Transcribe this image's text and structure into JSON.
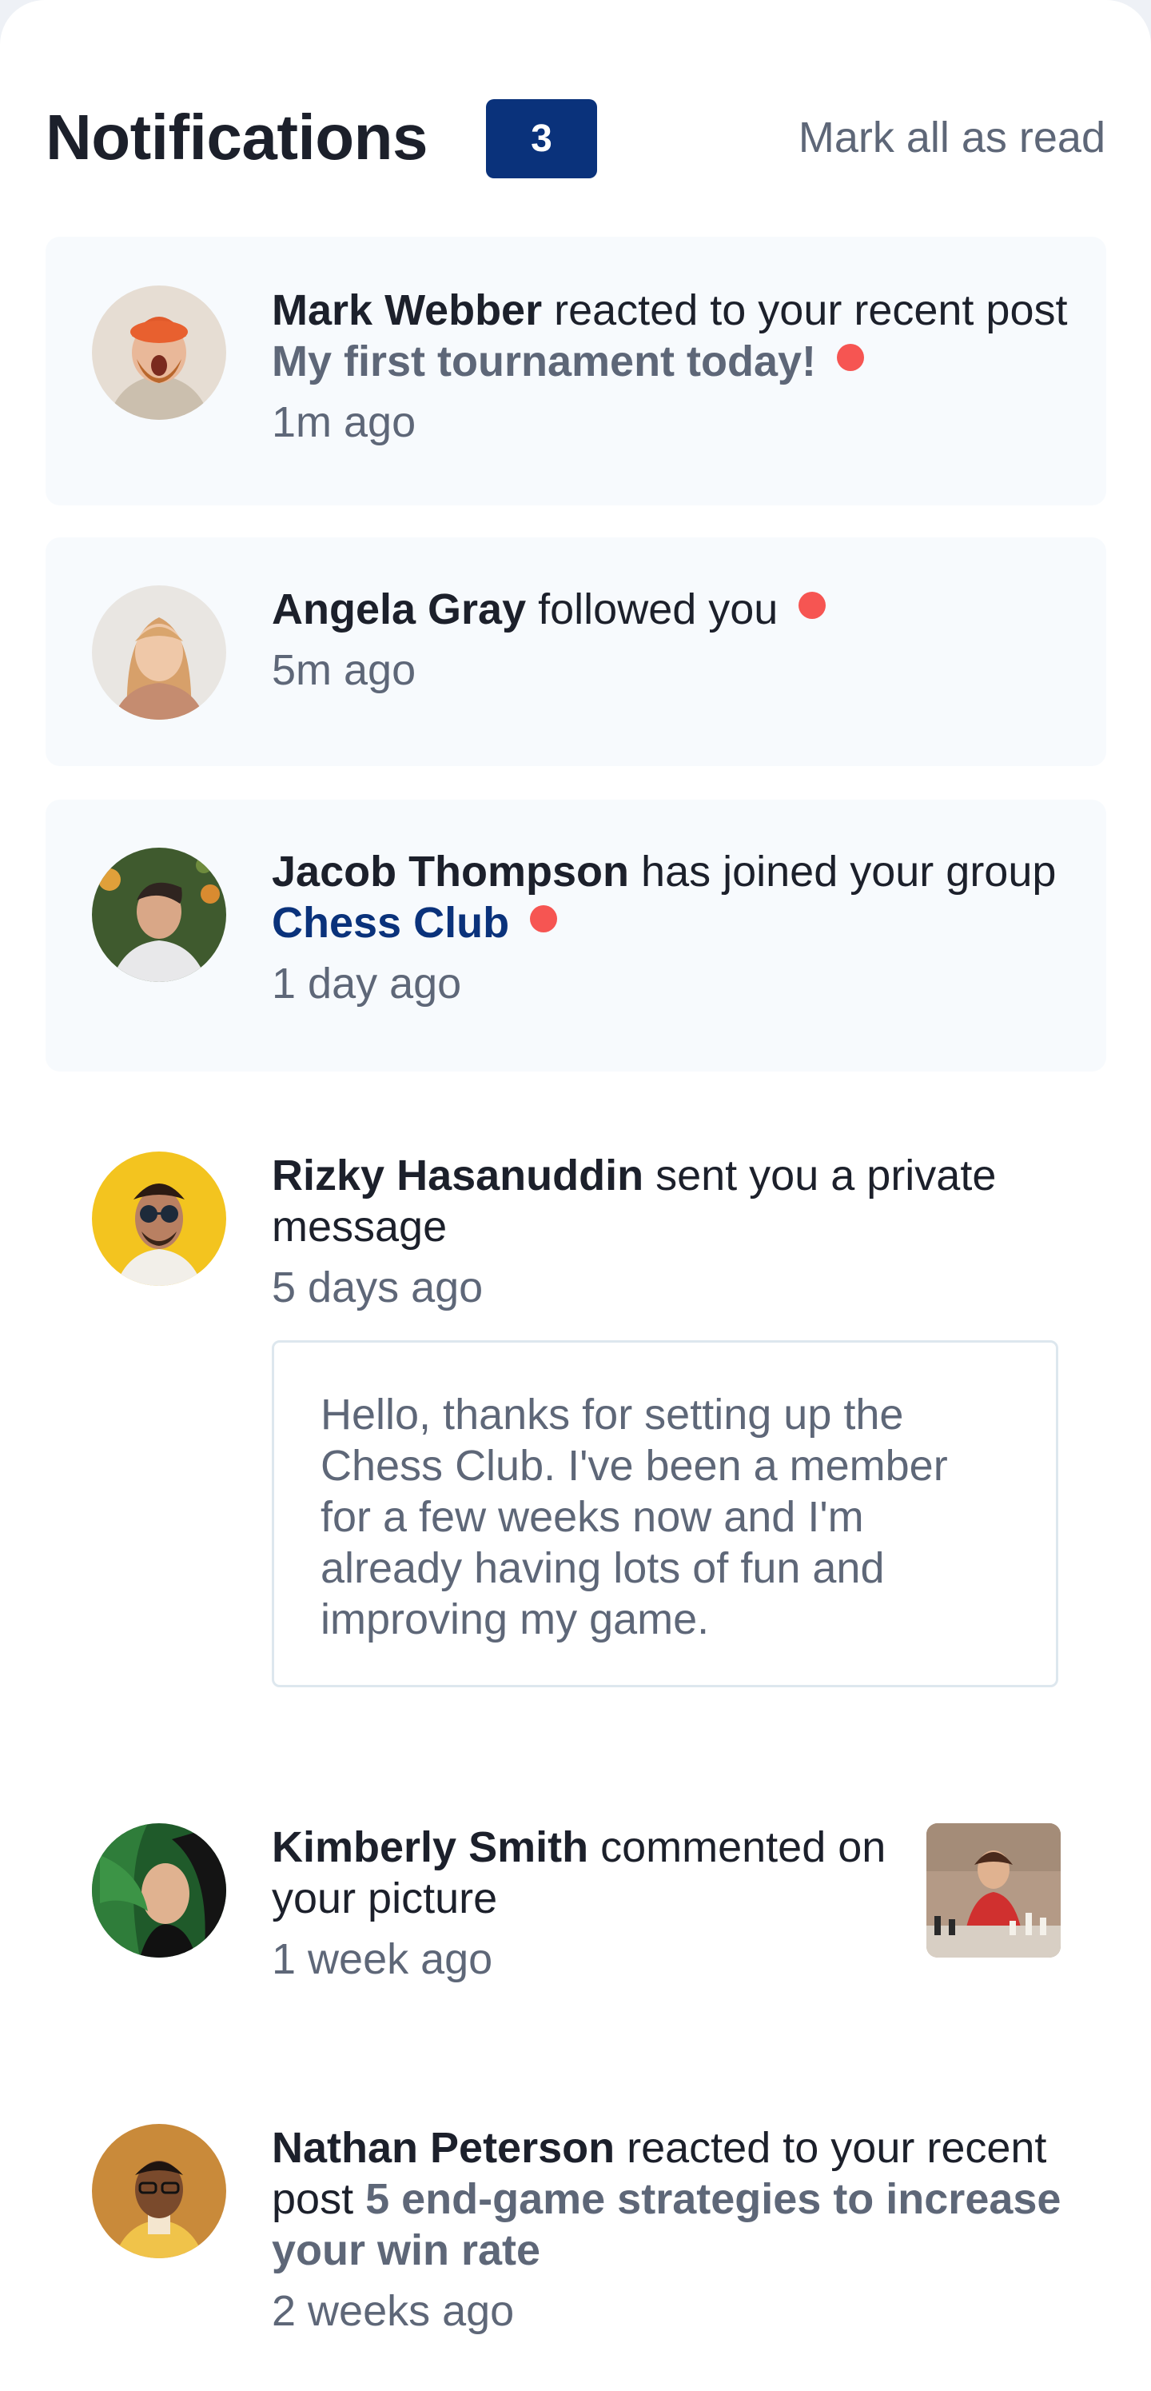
{
  "header": {
    "title": "Notifications",
    "unread_count": "3",
    "mark_all_label": "Mark all as read"
  },
  "colors": {
    "badge": "#0a327b",
    "unread_dot": "#f65552",
    "unread_bg": "#f7fafd",
    "heading_text": "#1c202b",
    "muted_text": "#5e6778"
  },
  "notifications": [
    {
      "name": "Mark Webber",
      "action": "reacted to your recent post",
      "target": "My first tournament today!",
      "time": "1m ago",
      "unread": true
    },
    {
      "name": "Angela Gray",
      "action": "followed you",
      "time": "5m ago",
      "unread": true
    },
    {
      "name": "Jacob Thompson",
      "action": "has joined your group",
      "target": "Chess Club",
      "time": "1 day ago",
      "unread": true
    },
    {
      "name": "Rizky Hasanuddin",
      "action": "sent you a private message",
      "time": "5 days ago",
      "unread": false,
      "message": "Hello, thanks for setting up the Chess Club. I've been a member for a few weeks now and I'm already having lots of fun and improving my game."
    },
    {
      "name": "Kimberly Smith",
      "action": "commented on your picture",
      "time": "1 week ago",
      "unread": false
    },
    {
      "name": "Nathan Peterson",
      "action": "reacted to your recent post",
      "target": "5 end-game strategies to increase your win rate",
      "time": "2 weeks ago",
      "unread": false
    }
  ]
}
